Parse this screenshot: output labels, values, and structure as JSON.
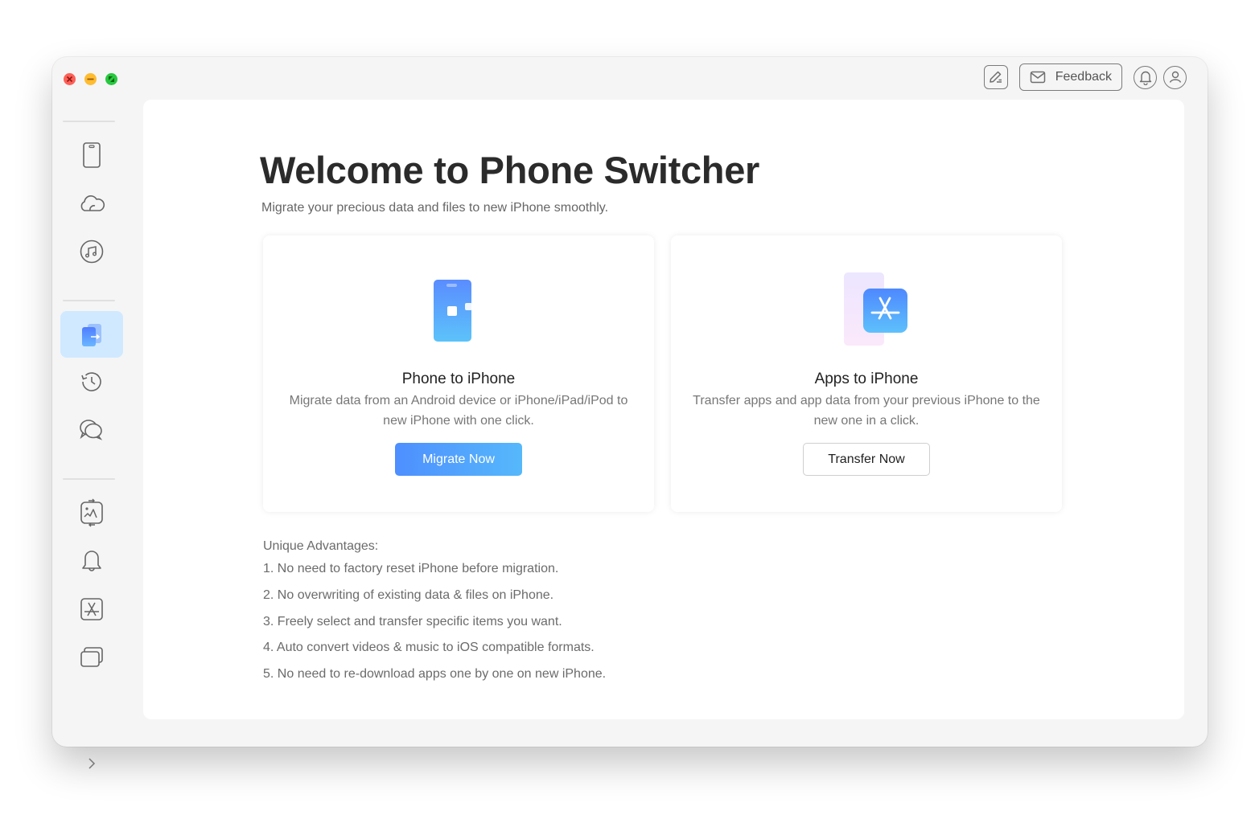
{
  "window": {
    "traffic_lights": [
      "close",
      "minimize",
      "maximize"
    ]
  },
  "topbar": {
    "edit_icon": "edit-note-icon",
    "feedback_label": "Feedback",
    "feedback_icon": "mail-icon",
    "notification_icon": "bell-icon",
    "account_icon": "user-icon"
  },
  "sidebar": {
    "groups": [
      [
        "device-manager",
        "icloud-manager",
        "itunes-library"
      ],
      [
        "phone-switcher",
        "backup-history",
        "social-messages"
      ],
      [
        "photo-transfer",
        "ringtone-maker",
        "app-manager",
        "screen-mirror"
      ]
    ],
    "active_item": "phone-switcher",
    "expand_icon": "chevron-right-icon"
  },
  "main": {
    "title": "Welcome to Phone Switcher",
    "subtitle": "Migrate your precious data and files to new iPhone smoothly.",
    "cards": [
      {
        "title": "Phone to iPhone",
        "description": "Migrate data from an Android device or iPhone/iPad/iPod to new iPhone with one click.",
        "button_label": "Migrate Now",
        "icon": "phone-transfer-icon"
      },
      {
        "title": "Apps to iPhone",
        "description": "Transfer apps and app data from your previous iPhone to the new one in a click.",
        "button_label": "Transfer Now",
        "icon": "app-store-icon"
      }
    ],
    "advantages": {
      "heading": "Unique Advantages:",
      "items": [
        "1. No need to factory reset iPhone before migration.",
        "2. No overwriting of existing data & files on iPhone.",
        "3. Freely select and transfer specific items you want.",
        "4. Auto convert videos & music to iOS compatible formats.",
        "5. No need to re-download apps one by one on new iPhone."
      ]
    }
  },
  "colors": {
    "accent_gradient_start": "#4e8fff",
    "accent_gradient_end": "#56b8fb",
    "active_sidebar_bg": "#d0e9ff",
    "window_bg": "#f5f5f5"
  }
}
